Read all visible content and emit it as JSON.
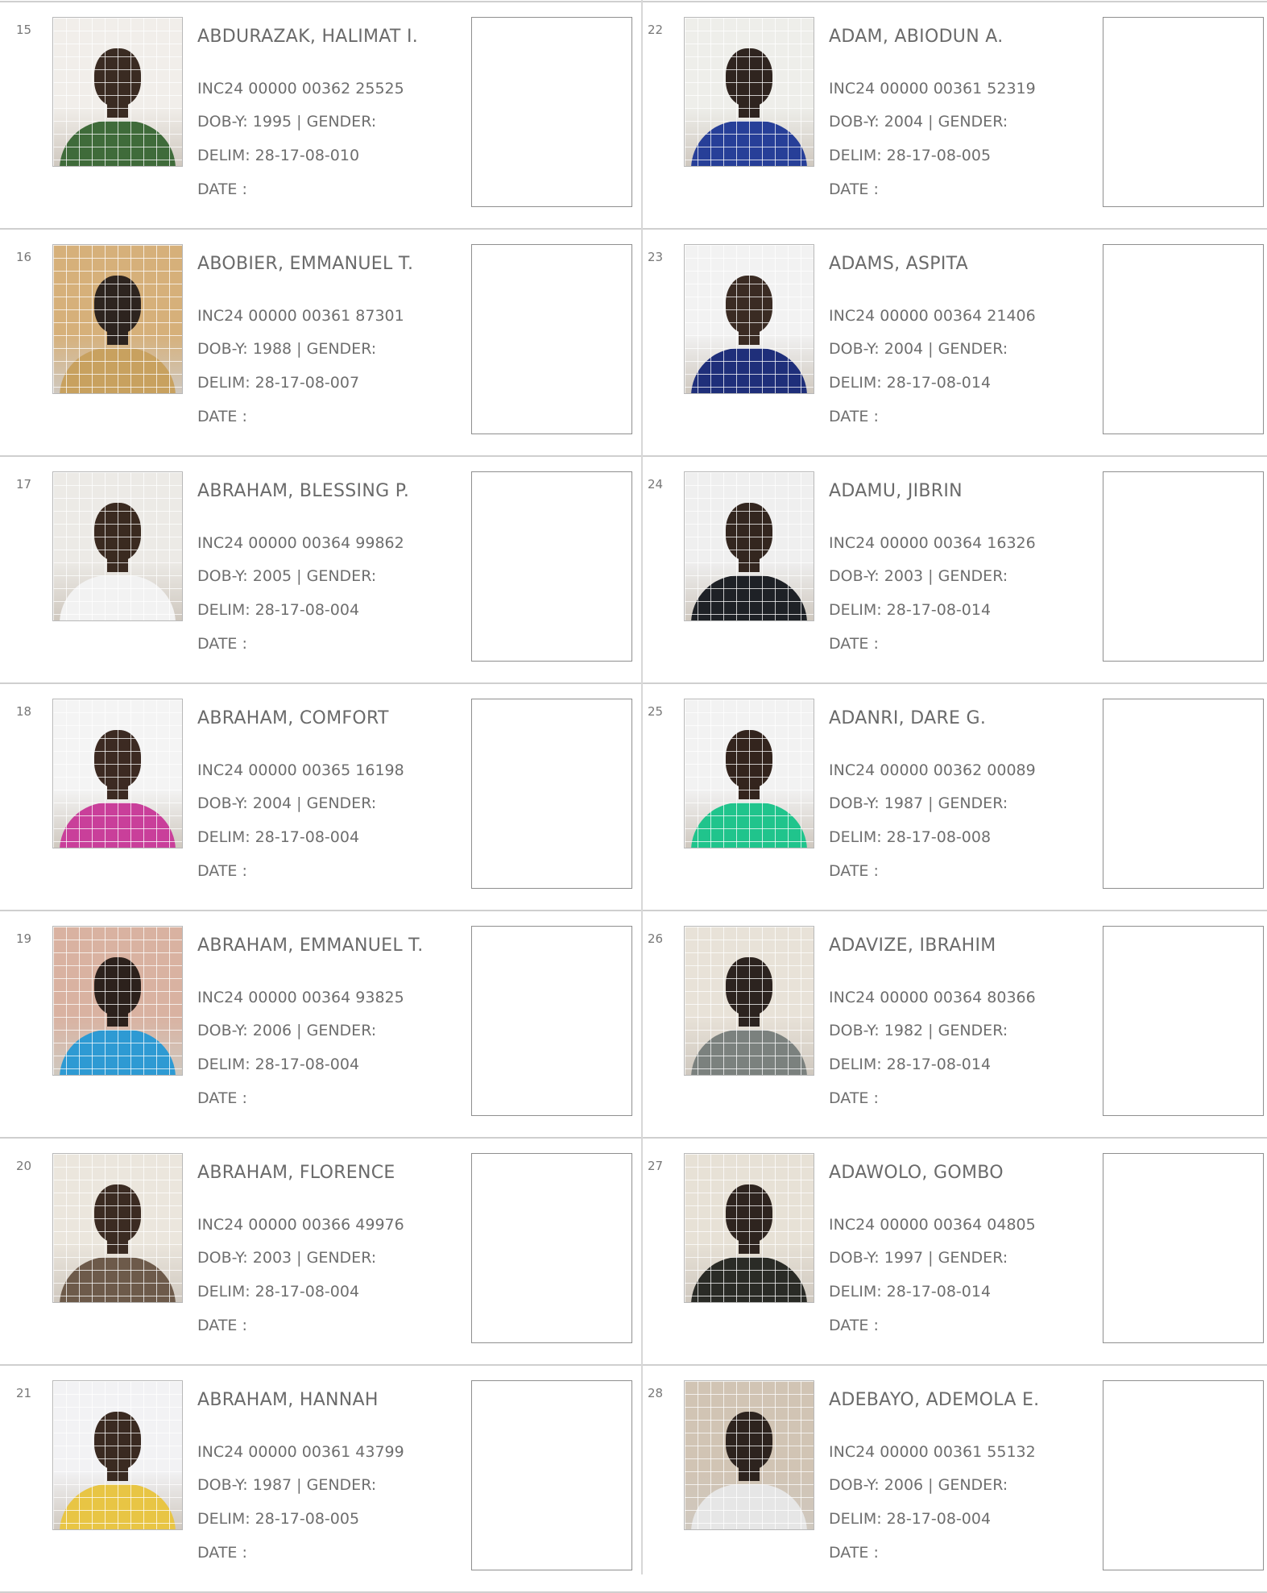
{
  "labels": {
    "dob": "DOB-Y:",
    "gender": "| GENDER:",
    "delim": "DELIM:",
    "date": "DATE  :"
  },
  "entries": [
    {
      "num": "15",
      "name": "ABDURAZAK, HALIMAT I.",
      "inc": "INC24 00000 00362 25525",
      "dob": "1995",
      "delim": "28-17-08-010"
    },
    {
      "num": "16",
      "name": "ABOBIER, EMMANUEL T.",
      "inc": "INC24 00000 00361 87301",
      "dob": "1988",
      "delim": "28-17-08-007"
    },
    {
      "num": "17",
      "name": "ABRAHAM, BLESSING P.",
      "inc": "INC24 00000 00364 99862",
      "dob": "2005",
      "delim": "28-17-08-004"
    },
    {
      "num": "18",
      "name": "ABRAHAM, COMFORT",
      "inc": "INC24 00000 00365 16198",
      "dob": "2004",
      "delim": "28-17-08-004"
    },
    {
      "num": "19",
      "name": "ABRAHAM, EMMANUEL T.",
      "inc": "INC24 00000 00364 93825",
      "dob": "2006",
      "delim": "28-17-08-004"
    },
    {
      "num": "20",
      "name": "ABRAHAM, FLORENCE",
      "inc": "INC24 00000 00366 49976",
      "dob": "2003",
      "delim": "28-17-08-004"
    },
    {
      "num": "21",
      "name": "ABRAHAM, HANNAH",
      "inc": "INC24 00000 00361 43799",
      "dob": "1987",
      "delim": "28-17-08-005"
    },
    {
      "num": "22",
      "name": "ADAM, ABIODUN A.",
      "inc": "INC24 00000 00361 52319",
      "dob": "2004",
      "delim": "28-17-08-005"
    },
    {
      "num": "23",
      "name": "ADAMS, ASPITA",
      "inc": "INC24 00000 00364 21406",
      "dob": "2004",
      "delim": "28-17-08-014"
    },
    {
      "num": "24",
      "name": "ADAMU, JIBRIN",
      "inc": "INC24 00000 00364 16326",
      "dob": "2003",
      "delim": "28-17-08-014"
    },
    {
      "num": "25",
      "name": "ADANRI, DARE G.",
      "inc": "INC24 00000 00362 00089",
      "dob": "1987",
      "delim": "28-17-08-008"
    },
    {
      "num": "26",
      "name": "ADAVIZE, IBRAHIM",
      "inc": "INC24 00000 00364 80366",
      "dob": "1982",
      "delim": "28-17-08-014"
    },
    {
      "num": "27",
      "name": "ADAWOLO, GOMBO",
      "inc": "INC24 00000 00364 04805",
      "dob": "1997",
      "delim": "28-17-08-014"
    },
    {
      "num": "28",
      "name": "ADEBAYO, ADEMOLA E.",
      "inc": "INC24 00000 00361 55132",
      "dob": "2006",
      "delim": "28-17-08-004"
    }
  ],
  "photo_colors": [
    {
      "bg": "#f1eeea",
      "skin": "#3a2b22",
      "shirt": "#3f6b3a"
    },
    {
      "bg": "#d6b07a",
      "skin": "#2d241f",
      "shirt": "#c8a15f"
    },
    {
      "bg": "#eceae6",
      "skin": "#3a2a20",
      "shirt": "#f2f2f2"
    },
    {
      "bg": "#f4f4f4",
      "skin": "#3c2a22",
      "shirt": "#c93f9a"
    },
    {
      "bg": "#d9b2a1",
      "skin": "#2c211c",
      "shirt": "#2e9ad3"
    },
    {
      "bg": "#ebe6dd",
      "skin": "#3b2b22",
      "shirt": "#6d5a4a"
    },
    {
      "bg": "#f2f2f4",
      "skin": "#3a2a21",
      "shirt": "#e8c544"
    },
    {
      "bg": "#eeeeea",
      "skin": "#2f241f",
      "shirt": "#273f98"
    },
    {
      "bg": "#f2f2f2",
      "skin": "#3a2b23",
      "shirt": "#1f2f7a"
    },
    {
      "bg": "#efefef",
      "skin": "#33261f",
      "shirt": "#1e2126"
    },
    {
      "bg": "#f2f2f2",
      "skin": "#33241d",
      "shirt": "#20c48c"
    },
    {
      "bg": "#e8e2d8",
      "skin": "#2c231f",
      "shirt": "#7b817e"
    },
    {
      "bg": "#e7e1d6",
      "skin": "#2e241f",
      "shirt": "#2a2b26"
    },
    {
      "bg": "#d1c4b4",
      "skin": "#2d231e",
      "shirt": "#e6e6e6"
    }
  ]
}
